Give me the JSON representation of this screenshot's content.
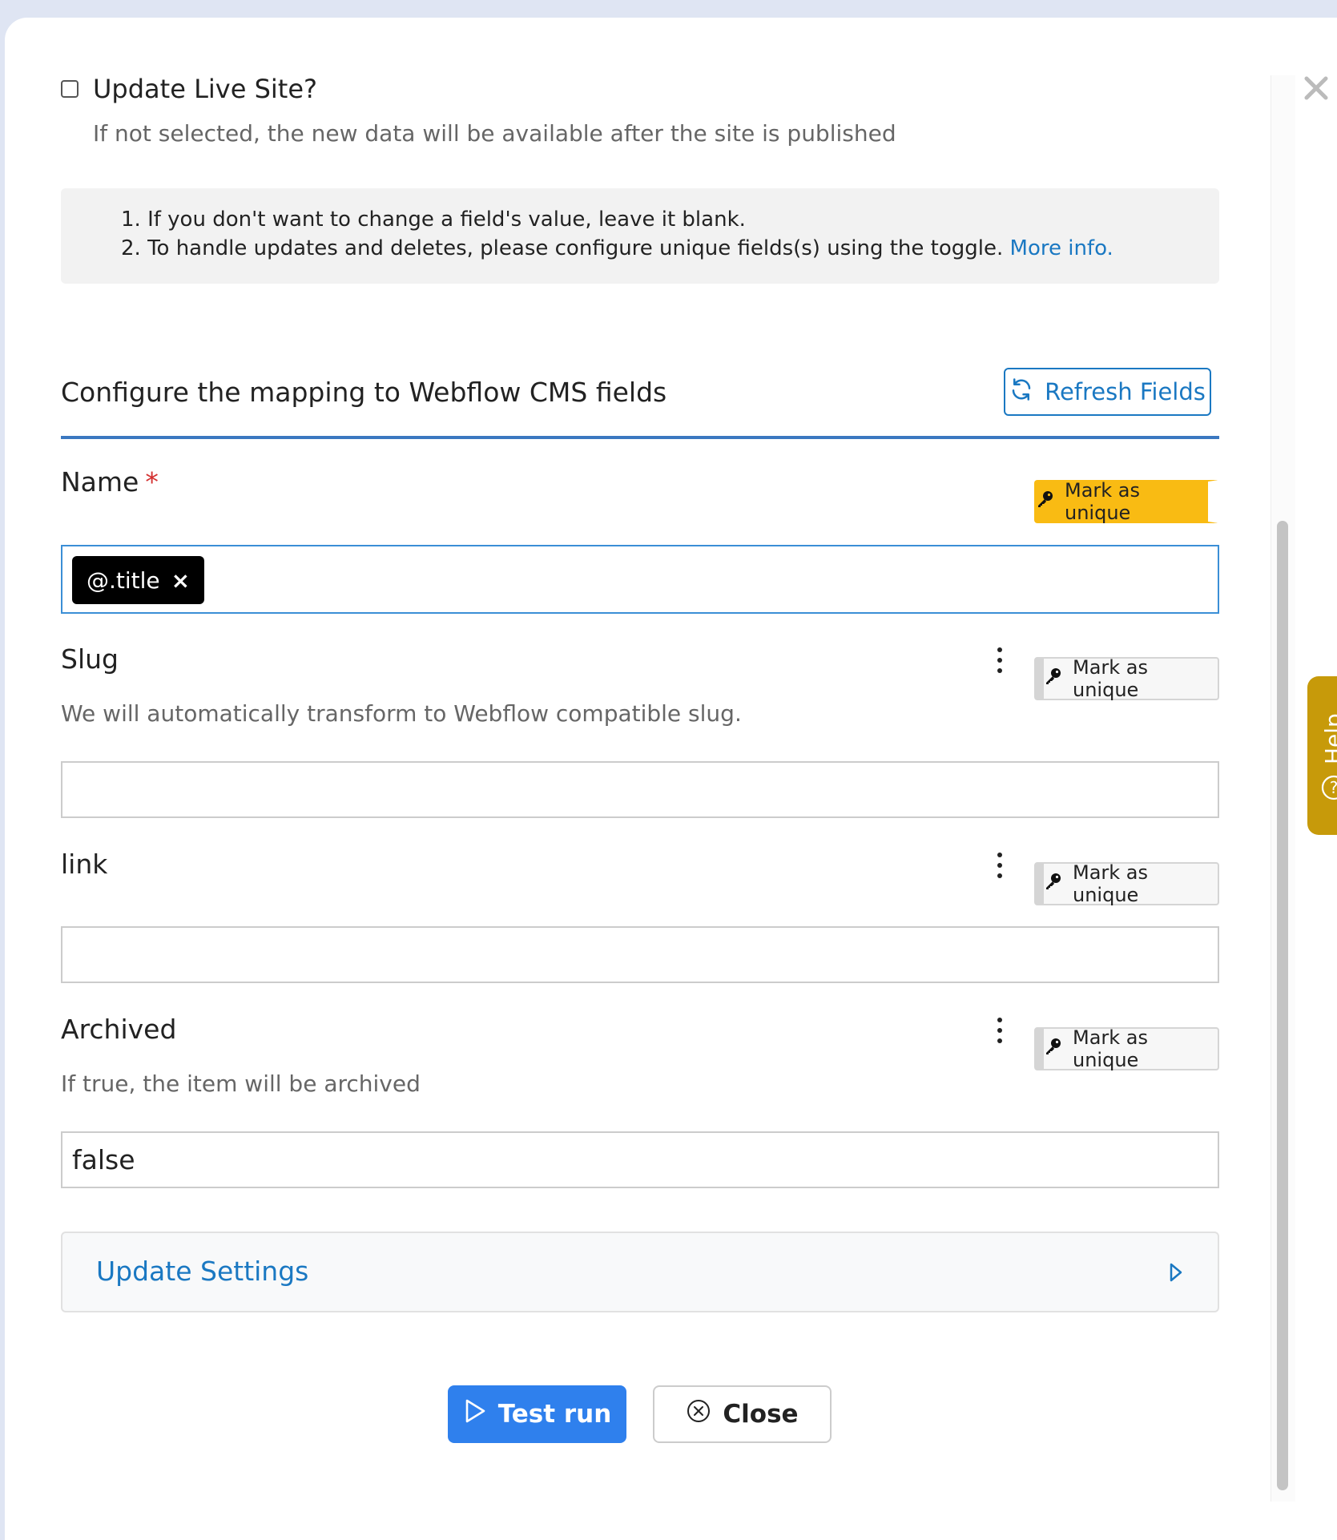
{
  "update_live": {
    "label": "Update Live Site?",
    "help": "If not selected, the new data will be available after the site is published",
    "checked": false
  },
  "notice": {
    "line1": "1. If you don't want to change a field's value, leave it blank.",
    "line2": "2. To handle updates and deletes, please configure unique fields(s) using the toggle.",
    "more_info": "More info."
  },
  "mapping": {
    "title": "Configure the mapping to Webflow CMS fields",
    "refresh_label": "Refresh Fields"
  },
  "fields": {
    "name": {
      "label": "Name",
      "required_mark": "*",
      "tag": "@.title",
      "tag_remove": "×",
      "unique_label": "Mark as unique",
      "unique_on": true
    },
    "slug": {
      "label": "Slug",
      "help": "We will automatically transform to Webflow compatible slug.",
      "value": "",
      "unique_label": "Mark as unique"
    },
    "link": {
      "label": "link",
      "value": "",
      "unique_label": "Mark as unique"
    },
    "archived": {
      "label": "Archived",
      "help": "If true, the item will be archived",
      "value": "false",
      "unique_label": "Mark as unique"
    }
  },
  "settings": {
    "title": "Update Settings"
  },
  "actions": {
    "test_run": "Test run",
    "close": "Close"
  },
  "side": {
    "help_label": "Help"
  },
  "colors": {
    "accent_blue": "#1a78c2",
    "button_blue": "#2f80ed",
    "unique_on": "#f9bb13",
    "help_tab": "#c79a0a"
  }
}
